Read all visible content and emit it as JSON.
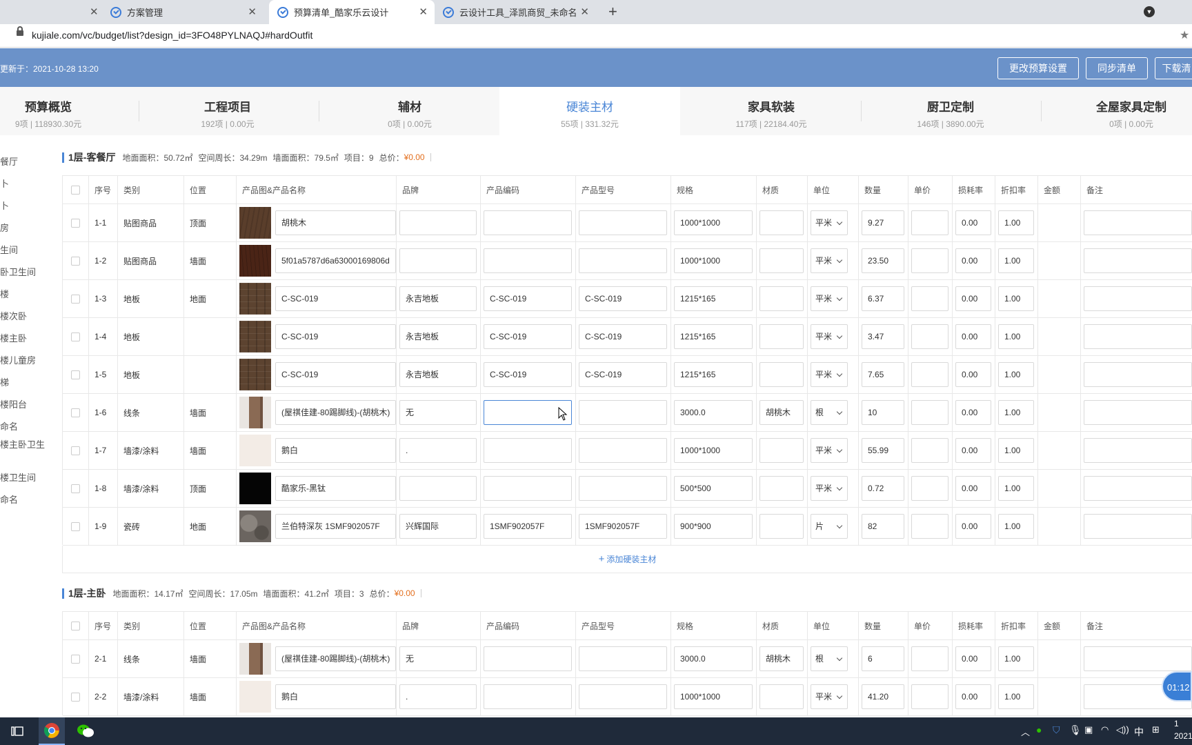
{
  "browser": {
    "tabs": [
      {
        "label": "方案管理",
        "active": false
      },
      {
        "label": "预算清单_酷家乐云设计",
        "active": true
      },
      {
        "label": "云设计工具_泽凯商贸_未命名",
        "active": false
      }
    ],
    "url": "kujiale.com/vc/budget/list?design_id=3FO48PYLNAQJ#hardOutfit"
  },
  "header": {
    "updated": "更新于：2021-10-28 13:20",
    "buttons": [
      "更改预算设置",
      "同步清单",
      "下载清"
    ]
  },
  "categories": [
    {
      "name": "预算概览",
      "meta": "9项 | 118930.30元",
      "active": false
    },
    {
      "name": "工程项目",
      "meta": "192项 | 0.00元",
      "active": false
    },
    {
      "name": "辅材",
      "meta": "0项 | 0.00元",
      "active": false
    },
    {
      "name": "硬装主材",
      "meta": "55项 | 331.32元",
      "active": true
    },
    {
      "name": "家具软装",
      "meta": "117项 | 22184.40元",
      "active": false
    },
    {
      "name": "厨卫定制",
      "meta": "146项 | 3890.00元",
      "active": false
    },
    {
      "name": "全屋家具定制",
      "meta": "0项 | 0.00元",
      "active": false
    }
  ],
  "rooms": [
    "餐厅",
    "卜",
    "卜",
    "房",
    "生间",
    "卧卫生间",
    "楼",
    "楼次卧",
    "楼主卧",
    "楼儿童房",
    "梯",
    "楼阳台",
    "命名",
    "楼主卧卫生",
    "楼卫生间",
    "命名"
  ],
  "columns": [
    "序号",
    "类别",
    "位置",
    "产品图&产品名称",
    "品牌",
    "产品编码",
    "产品型号",
    "规格",
    "材质",
    "单位",
    "数量",
    "单价",
    "损耗率",
    "折扣率",
    "金额",
    "备注"
  ],
  "sections": [
    {
      "title": "1层-客餐厅",
      "area": "地面面积：50.72㎡",
      "perimeter": "空间周长：34.29m",
      "wall": "墙面面积：79.5㎡",
      "count": "项目：9",
      "total_label": "总价：",
      "total": "¥0.00",
      "rows": [
        {
          "no": "1-1",
          "type": "贴图商品",
          "pos": "顶面",
          "name": "胡桃木",
          "brand": "",
          "code": "",
          "model": "",
          "spec": "1000*1000",
          "material": "",
          "unit": "平米",
          "qty": "9.27",
          "price": "",
          "loss": "0.00",
          "disc": "1.00",
          "thumb": "#5a3e2b"
        },
        {
          "no": "1-2",
          "type": "贴图商品",
          "pos": "墙面",
          "name": "5f01a5787d6a63000169806d",
          "brand": "",
          "code": "",
          "model": "",
          "spec": "1000*1000",
          "material": "",
          "unit": "平米",
          "qty": "23.50",
          "price": "",
          "loss": "0.00",
          "disc": "1.00",
          "thumb": "#4a2416"
        },
        {
          "no": "1-3",
          "type": "地板",
          "pos": "地面",
          "name": "C-SC-019",
          "brand": "永吉地板",
          "code": "C-SC-019",
          "model": "C-SC-019",
          "spec": "1215*165",
          "material": "",
          "unit": "平米",
          "qty": "6.37",
          "price": "",
          "loss": "0.00",
          "disc": "1.00",
          "thumb": "#5c4330"
        },
        {
          "no": "1-4",
          "type": "地板",
          "pos": "",
          "name": "C-SC-019",
          "brand": "永吉地板",
          "code": "C-SC-019",
          "model": "C-SC-019",
          "spec": "1215*165",
          "material": "",
          "unit": "平米",
          "qty": "3.47",
          "price": "",
          "loss": "0.00",
          "disc": "1.00",
          "thumb": "#5c4330"
        },
        {
          "no": "1-5",
          "type": "地板",
          "pos": "",
          "name": "C-SC-019",
          "brand": "永吉地板",
          "code": "C-SC-019",
          "model": "C-SC-019",
          "spec": "1215*165",
          "material": "",
          "unit": "平米",
          "qty": "7.65",
          "price": "",
          "loss": "0.00",
          "disc": "1.00",
          "thumb": "#5c4330"
        },
        {
          "no": "1-6",
          "type": "线条",
          "pos": "墙面",
          "name": "(屋祺佳建-80踢脚线)-(胡桃木)",
          "brand": "无",
          "code": "",
          "model": "",
          "spec": "3000.0",
          "material": "胡桃木",
          "unit": "根",
          "qty": "10",
          "price": "",
          "loss": "0.00",
          "disc": "1.00",
          "thumb": "#8a6a54"
        },
        {
          "no": "1-7",
          "type": "墙漆/涂料",
          "pos": "墙面",
          "name": "鹅白",
          "brand": ".",
          "code": "",
          "model": "",
          "spec": "1000*1000",
          "material": "",
          "unit": "平米",
          "qty": "55.99",
          "price": "",
          "loss": "0.00",
          "disc": "1.00",
          "thumb": "#f3ece6"
        },
        {
          "no": "1-8",
          "type": "墙漆/涂料",
          "pos": "顶面",
          "name": "酷家乐-黑钛",
          "brand": "",
          "code": "",
          "model": "",
          "spec": "500*500",
          "material": "",
          "unit": "平米",
          "qty": "0.72",
          "price": "",
          "loss": "0.00",
          "disc": "1.00",
          "thumb": "#050505"
        },
        {
          "no": "1-9",
          "type": "瓷砖",
          "pos": "地面",
          "name": "兰伯特深灰 1SMF902057F",
          "brand": "兴辉国际",
          "code": "1SMF902057F",
          "model": "1SMF902057F",
          "spec": "900*900",
          "material": "",
          "unit": "片",
          "qty": "82",
          "price": "",
          "loss": "0.00",
          "disc": "1.00",
          "thumb": "#6b6560"
        }
      ],
      "add_label": "添加硬装主材"
    },
    {
      "title": "1层-主卧",
      "area": "地面面积：14.17㎡",
      "perimeter": "空间周长：17.05m",
      "wall": "墙面面积：41.2㎡",
      "count": "项目：3",
      "total_label": "总价：",
      "total": "¥0.00",
      "rows": [
        {
          "no": "2-1",
          "type": "线条",
          "pos": "墙面",
          "name": "(屋祺佳建-80踢脚线)-(胡桃木)",
          "brand": "无",
          "code": "",
          "model": "",
          "spec": "3000.0",
          "material": "胡桃木",
          "unit": "根",
          "qty": "6",
          "price": "",
          "loss": "0.00",
          "disc": "1.00",
          "thumb": "#8a6a54"
        },
        {
          "no": "2-2",
          "type": "墙漆/涂料",
          "pos": "墙面",
          "name": "鹅白",
          "brand": ".",
          "code": "",
          "model": "",
          "spec": "1000*1000",
          "material": "",
          "unit": "平米",
          "qty": "41.20",
          "price": "",
          "loss": "0.00",
          "disc": "1.00",
          "thumb": "#f3ece6"
        }
      ]
    }
  ],
  "timer": "01:12",
  "taskbar": {
    "ime": "中",
    "clock_time": "1",
    "clock_date": "2021"
  }
}
